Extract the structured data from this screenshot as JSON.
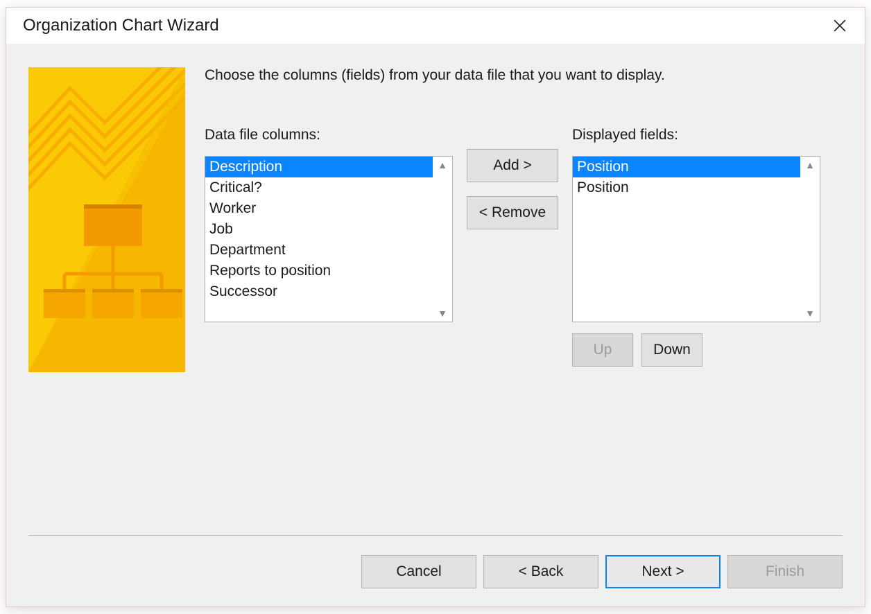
{
  "title": "Organization Chart Wizard",
  "instruction": "Choose the columns (fields) from your data file that you want to display.",
  "labels": {
    "data_columns": "Data file columns:",
    "displayed_fields": "Displayed fields:"
  },
  "buttons": {
    "add": "Add >",
    "remove": "< Remove",
    "up": "Up",
    "down": "Down",
    "cancel": "Cancel",
    "back": "< Back",
    "next": "Next >",
    "finish": "Finish"
  },
  "data_file_columns": [
    {
      "label": "Description",
      "selected": true
    },
    {
      "label": "Critical?",
      "selected": false
    },
    {
      "label": "Worker",
      "selected": false
    },
    {
      "label": "Job",
      "selected": false
    },
    {
      "label": "Department",
      "selected": false
    },
    {
      "label": "Reports to position",
      "selected": false
    },
    {
      "label": "Successor",
      "selected": false
    }
  ],
  "displayed_fields": [
    {
      "label": "Position",
      "selected": true
    },
    {
      "label": "Position",
      "selected": false
    }
  ],
  "button_state": {
    "up_disabled": true,
    "down_enabled": true,
    "finish_disabled": true,
    "next_focused": true
  }
}
